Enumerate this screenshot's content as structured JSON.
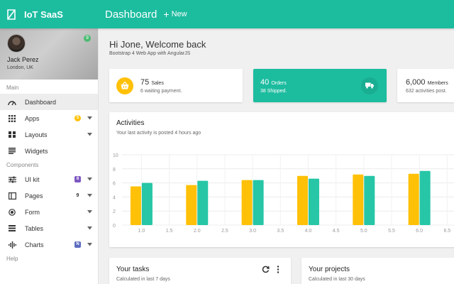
{
  "topbar": {
    "brand": "IoT SaaS",
    "page_title": "Dashboard",
    "new_label": "New",
    "color": "#1cbc9f"
  },
  "profile": {
    "name": "Jack Perez",
    "location": "London, UK",
    "badge": "9"
  },
  "sidebar": {
    "section_main": "Main",
    "section_components": "Components",
    "section_help": "Help",
    "items": [
      {
        "label": "Dashboard",
        "icon": "dashboard-icon",
        "active": true
      },
      {
        "label": "Apps",
        "icon": "apps-grid-icon",
        "badge": "5",
        "badge_color": "#ffc107",
        "expandable": true
      },
      {
        "label": "Layouts",
        "icon": "layouts-icon",
        "expandable": true
      },
      {
        "label": "Widgets",
        "icon": "widgets-icon"
      },
      {
        "label": "UI kit",
        "icon": "sliders-icon",
        "badge": "8",
        "badge_color": "#7e57c2",
        "expandable": true
      },
      {
        "label": "Pages",
        "icon": "pages-icon",
        "badge": "9",
        "expandable": true
      },
      {
        "label": "Form",
        "icon": "radio-icon",
        "expandable": true
      },
      {
        "label": "Tables",
        "icon": "table-icon",
        "expandable": true
      },
      {
        "label": "Charts",
        "icon": "chart-icon",
        "badge": "N",
        "badge_color": "#5c6bc0",
        "expandable": true
      }
    ]
  },
  "header": {
    "greeting": "Hi Jone, Welcome back",
    "subtitle": "Bootstrap 4 Web App with AngularJS"
  },
  "stats": {
    "sales": {
      "value": "75",
      "unit": "Sales",
      "sub": "6 waiting payment.",
      "color": "#ffc107",
      "icon": "basket-icon"
    },
    "orders": {
      "value": "40",
      "unit": "Orders",
      "sub": "38 Shipped.",
      "icon": "truck-icon"
    },
    "members": {
      "value": "6,000",
      "unit": "Members",
      "sub": "632 activities post."
    }
  },
  "activities": {
    "title": "Activities",
    "subtitle": "Your last activity is posted 4 hours ago"
  },
  "chart_data": {
    "type": "bar",
    "x": [
      1.0,
      2.0,
      3.0,
      4.0,
      5.0,
      6.0
    ],
    "x_ticks": [
      "1.0",
      "1.5",
      "2.0",
      "2.5",
      "3.0",
      "3.5",
      "4.0",
      "4.5",
      "5.0",
      "5.5",
      "6.0",
      "6.5"
    ],
    "y_ticks": [
      "0",
      "2",
      "4",
      "6",
      "8",
      "10"
    ],
    "ylim": [
      0,
      10
    ],
    "xlim": [
      0.65,
      6.7
    ],
    "grid": true,
    "series": [
      {
        "color": "#ffc107",
        "values": [
          5.5,
          5.7,
          6.4,
          7.0,
          7.2,
          7.3
        ]
      },
      {
        "color": "#26c6a6",
        "values": [
          6.0,
          6.3,
          6.4,
          6.6,
          7.0,
          7.7
        ]
      }
    ]
  },
  "tasks": {
    "title": "Your tasks",
    "subtitle": "Calculated in last 7 days"
  },
  "projects": {
    "title": "Your projects",
    "subtitle": "Calculated in last 30 days"
  }
}
